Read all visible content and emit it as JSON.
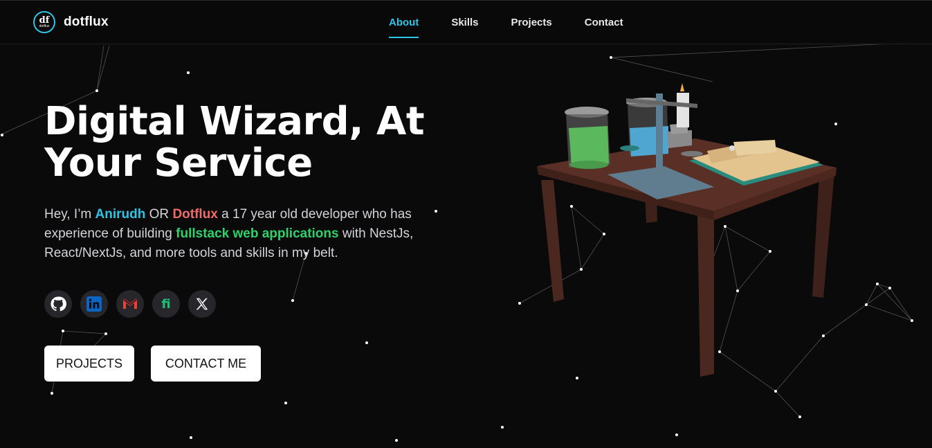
{
  "brand": {
    "logo_glyph": "df",
    "logo_subtext": "dotflux",
    "name": "dotflux"
  },
  "nav": [
    {
      "label": "About",
      "active": true
    },
    {
      "label": "Skills",
      "active": false
    },
    {
      "label": "Projects",
      "active": false
    },
    {
      "label": "Contact",
      "active": false
    }
  ],
  "hero": {
    "title_line1": "Digital Wizard, At",
    "title_line2": "Your Service",
    "intro_pre": "Hey, I’m ",
    "name": "Anirudh",
    "or": " OR ",
    "alias": "Dotflux",
    "intro_mid": " a 17 year old developer who has experience of building ",
    "highlight": "fullstack web applications",
    "intro_post": " with NestJs, React/NextJs, and more tools and skills in my belt."
  },
  "socials": [
    {
      "name": "github",
      "icon": "github-icon"
    },
    {
      "name": "linkedin",
      "icon": "linkedin-icon"
    },
    {
      "name": "gmail",
      "icon": "gmail-icon"
    },
    {
      "name": "fiverr",
      "icon": "fiverr-icon"
    },
    {
      "name": "x",
      "icon": "x-icon"
    }
  ],
  "buttons": {
    "projects": "PROJECTS",
    "contact": "CONTACT ME"
  },
  "colors": {
    "accent": "#2ec4e6",
    "name_highlight": "#2ec4e6",
    "alias_highlight": "#f26b6b",
    "skill_highlight": "#2fd16a",
    "background": "#0a0a0b"
  }
}
